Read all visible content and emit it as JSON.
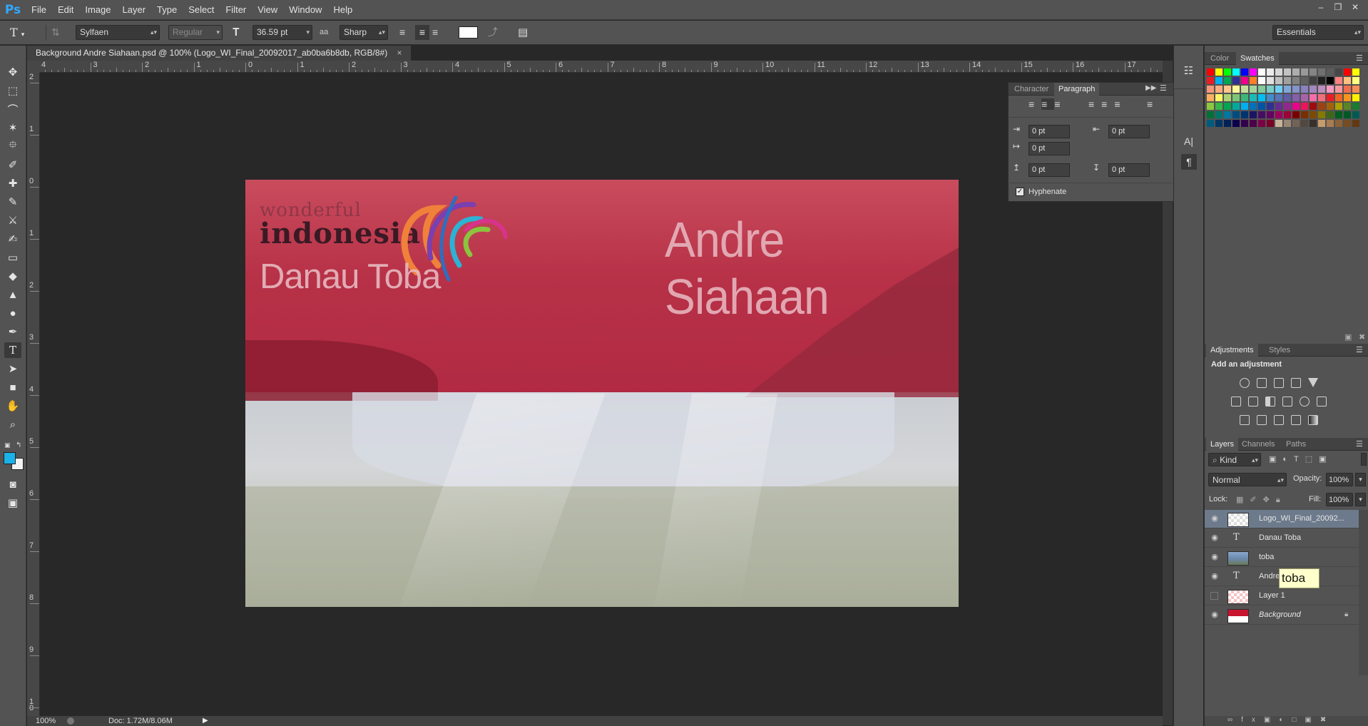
{
  "app": {
    "logo": "Ps"
  },
  "menu": [
    "File",
    "Edit",
    "Image",
    "Layer",
    "Type",
    "Select",
    "Filter",
    "View",
    "Window",
    "Help"
  ],
  "options_bar": {
    "font_family": "Sylfaen",
    "font_style": "Regular",
    "font_size": "36.59 pt",
    "anti_alias": "Sharp",
    "text_color": "#ffffff",
    "workspace": "Essentials"
  },
  "document": {
    "tab_title": "Background Andre Siahaan.psd @ 100% (Logo_WI_Final_20092017_ab0ba6b8db, RGB/8#)",
    "close_glyph": "×",
    "zoom": "100%",
    "doc_size": "Doc: 1.72M/8.06M"
  },
  "ruler_top": [
    "4",
    "3",
    "2",
    "1",
    "0",
    "1",
    "2",
    "3",
    "4",
    "5",
    "6",
    "7",
    "8",
    "9",
    "10",
    "11",
    "12",
    "13",
    "14",
    "15",
    "16",
    "17"
  ],
  "ruler_left": [
    "2",
    "1",
    "0",
    "1",
    "2",
    "3",
    "4",
    "5",
    "6",
    "7",
    "8",
    "9",
    "1\n0"
  ],
  "canvas": {
    "logo_line1": "wonderful",
    "logo_line2": "indonesia",
    "logo_line3": "Danau Toba",
    "headline": "Andre Siahaan",
    "flag_red": "#b83149",
    "flag_white": "#d2d5d9"
  },
  "color_panel": {
    "tabs": [
      "Color",
      "Swatches"
    ],
    "active": "Swatches"
  },
  "swatch_colors": [
    [
      "#ff0000",
      "#ffff00",
      "#00ff00",
      "#00ffff",
      "#0000ff",
      "#ff00ff",
      "#ffffff",
      "#ebebeb",
      "#d6d6d6",
      "#c2c2c2",
      "#adadad",
      "#999999",
      "#858585",
      "#707070",
      "#5c5c5c",
      "#474747",
      "#ff0000",
      "#ffff00"
    ],
    [
      "#ed1c24",
      "#00aeef",
      "#00a651",
      "#2e3192",
      "#ec008c",
      "#ff7f27",
      "#ffffff",
      "#e0e0e0",
      "#c0c0c0",
      "#a0a0a0",
      "#808080",
      "#606060",
      "#404040",
      "#202020",
      "#000000",
      "#ff8080",
      "#ffc080",
      "#ffff80"
    ],
    [
      "#f7977a",
      "#f9ad81",
      "#fdc68a",
      "#fff79a",
      "#c4df9b",
      "#a3d39c",
      "#82ca9d",
      "#7bcdc8",
      "#6ecff6",
      "#7ea7d8",
      "#8493ca",
      "#8882be",
      "#a187be",
      "#bc8dbf",
      "#f49ac2",
      "#f6989d",
      "#f26c4f",
      "#f68e55"
    ],
    [
      "#fbaf5d",
      "#fff467",
      "#acd372",
      "#7cc576",
      "#3bb878",
      "#1abbb4",
      "#00bff3",
      "#438ccb",
      "#5574b9",
      "#605ca8",
      "#855fa8",
      "#a763a8",
      "#f06eaa",
      "#f26d7d",
      "#ed1c24",
      "#f26522",
      "#f7941d",
      "#fff200"
    ],
    [
      "#8dc73f",
      "#39b54a",
      "#00a651",
      "#00a99d",
      "#00aeef",
      "#0072bc",
      "#0054a6",
      "#2e3192",
      "#662d91",
      "#92278f",
      "#ec008c",
      "#ed145b",
      "#9e0b0f",
      "#a0410d",
      "#a3620a",
      "#aba000",
      "#598527",
      "#197b30"
    ],
    [
      "#007236",
      "#00746b",
      "#0076a3",
      "#004b80",
      "#003471",
      "#1b1464",
      "#440e62",
      "#630460",
      "#9e005d",
      "#9e0039",
      "#790000",
      "#7b2e00",
      "#7d4900",
      "#827b00",
      "#406618",
      "#005e20",
      "#005826",
      "#005952"
    ],
    [
      "#005b7f",
      "#003663",
      "#002157",
      "#0d004c",
      "#32004b",
      "#4b0049",
      "#7b0046",
      "#7a0026",
      "#c7b299",
      "#998675",
      "#736357",
      "#534741",
      "#37302d",
      "#c69c6d",
      "#a67c52",
      "#8c6239",
      "#754c24",
      "#603913"
    ]
  ],
  "paragraph_panel": {
    "tabs": [
      "Character",
      "Paragraph"
    ],
    "active": "Paragraph",
    "indent_left": "0 pt",
    "indent_right": "0 pt",
    "indent_first": "0 pt",
    "space_before": "0 pt",
    "space_after": "0 pt",
    "hyphenate_label": "Hyphenate",
    "hyphenate_checked": true
  },
  "adjustments_panel": {
    "tabs": [
      "Adjustments",
      "Styles"
    ],
    "heading": "Add an adjustment"
  },
  "layers_panel": {
    "tabs": [
      "Layers",
      "Channels",
      "Paths"
    ],
    "filter": "Kind",
    "blend_mode": "Normal",
    "opacity_label": "Opacity:",
    "opacity": "100%",
    "lock_label": "Lock:",
    "fill_label": "Fill:",
    "fill": "100%",
    "layers": [
      {
        "name": "Logo_WI_Final_20092...",
        "type": "smart",
        "visible": true,
        "selected": true
      },
      {
        "name": "Danau Toba",
        "type": "text",
        "visible": true,
        "selected": false
      },
      {
        "name": "toba",
        "type": "image",
        "visible": true,
        "selected": false
      },
      {
        "name": "Andre",
        "type": "text",
        "visible": true,
        "selected": false
      },
      {
        "name": "Layer 1",
        "type": "pixel",
        "visible": false,
        "selected": false
      },
      {
        "name": "Background",
        "type": "background",
        "visible": true,
        "selected": false,
        "locked": true
      }
    ],
    "tooltip": "toba"
  }
}
